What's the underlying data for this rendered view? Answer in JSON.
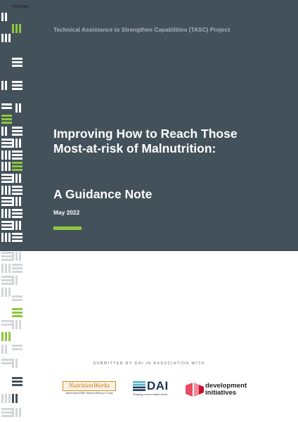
{
  "header": {
    "official_label": "OFFICIAL",
    "project": "Technical Assistance to Strengthen Capabilities (TASC) Project",
    "title_line1": "Improving How to Reach Those",
    "title_line2": "Most-at-risk of Malnutrition:",
    "subtitle": "A Guidance Note",
    "date": "May 2022"
  },
  "footer": {
    "submitted": "SUBMITTED BY DAI IN ASSOCIATION WITH",
    "logos": {
      "nutritionworks": {
        "name": "NutritionWorks",
        "tagline": "International Public Nutrition Resource Group"
      },
      "dai": {
        "name": "DAI",
        "tagline": "Shaping a more livable world."
      },
      "development_initiatives": {
        "line1": "development",
        "line2": "initiatives"
      }
    }
  },
  "colors": {
    "header_bg": "#43515a",
    "accent_green": "#8dc63f",
    "project_text": "#a6b0b7"
  }
}
